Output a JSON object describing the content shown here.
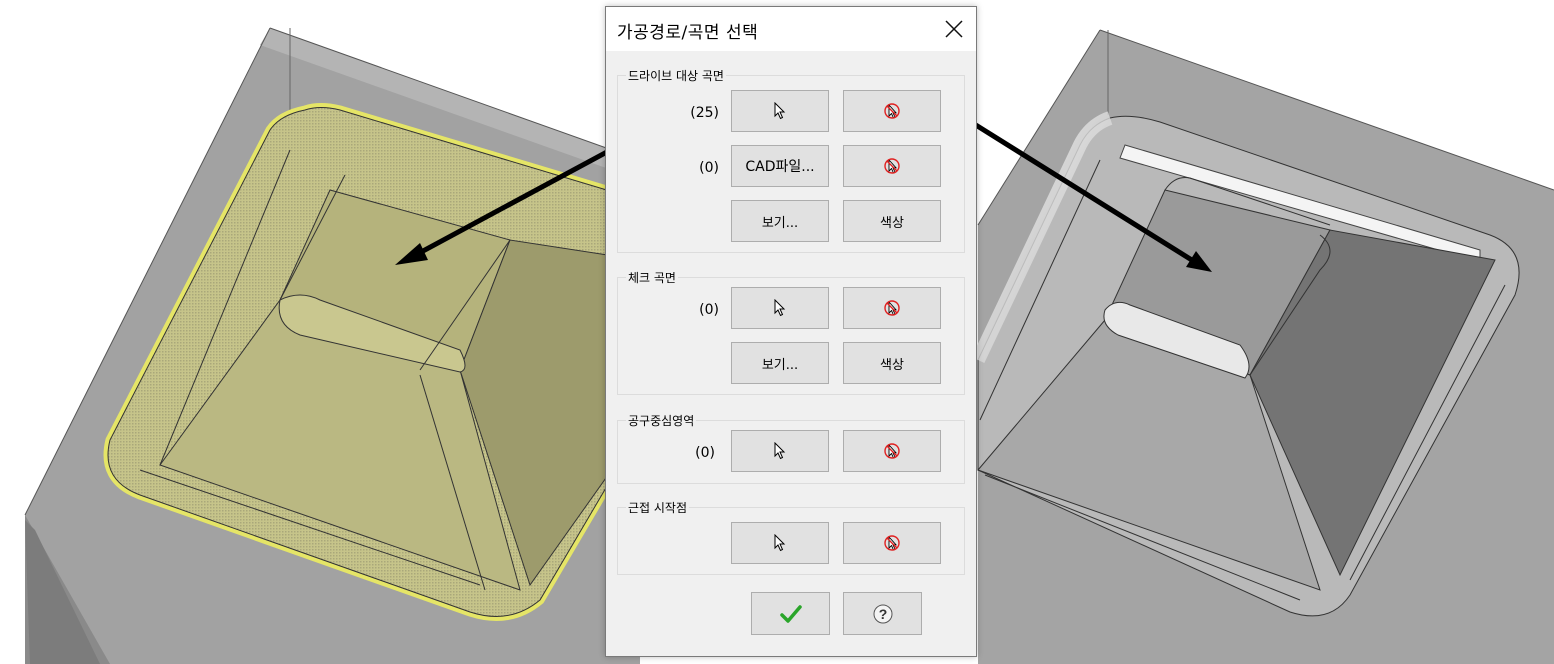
{
  "dialog": {
    "title": "가공경로/곡면 선택",
    "drive": {
      "label": "드라이브 대상 곡면",
      "count1": "(25)",
      "count2": "(0)",
      "cad_label": "CAD파일...",
      "view_label": "보기...",
      "color_label": "색상"
    },
    "check": {
      "label": "체크 곡면",
      "count": "(0)",
      "view_label": "보기...",
      "color_label": "색상"
    },
    "tool_center": {
      "label": "공구중심영역",
      "count": "(0)"
    },
    "approach": {
      "label": "근접 시작점"
    }
  },
  "icons": {
    "select": "cursor-arrow-icon",
    "deselect": "cursor-cancel-icon",
    "ok": "green-checkmark-icon",
    "help": "help-question-icon",
    "close": "close-x-icon"
  },
  "colors": {
    "selection_highlight": "#e8e84a",
    "cancel_red": "#e02020",
    "ok_green": "#2aa52a"
  }
}
